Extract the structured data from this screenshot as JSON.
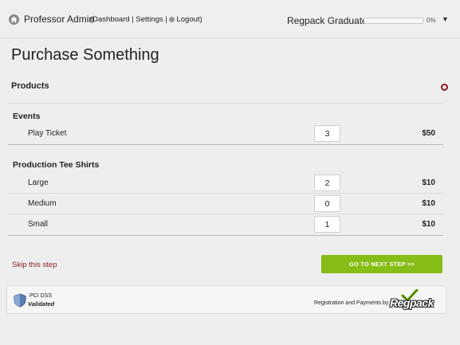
{
  "header": {
    "user_name": "Professor Admin",
    "paren_open": "(",
    "dashboard_link": "Dashboard",
    "sep1": " | ",
    "settings_link": "Settings",
    "sep2": " | ",
    "logout_link": "Logout",
    "paren_close": ")",
    "course_name": "Regpack Graduate",
    "progress_text": "0%",
    "progress_value": 0,
    "dropdown_caret": "▼"
  },
  "page": {
    "title": "Purchase Something"
  },
  "products": {
    "header": "Products",
    "sections": [
      {
        "title": "Events",
        "items": [
          {
            "label": "Play Ticket",
            "qty": "3",
            "price": "$50"
          }
        ]
      },
      {
        "title": "Production Tee Shirts",
        "items": [
          {
            "label": "Large",
            "qty": "2",
            "price": "$10"
          },
          {
            "label": "Medium",
            "qty": "0",
            "price": "$10"
          },
          {
            "label": "Small",
            "qty": "1",
            "price": "$10"
          }
        ]
      }
    ]
  },
  "actions": {
    "skip_label": "Skip this step",
    "next_label": "GO TO NEXT STEP >>"
  },
  "footer": {
    "pci_line1": "PCI DSS",
    "pci_line2": "Validated",
    "powered_by": "Registration and Payments by",
    "brand_name": "Regpack"
  },
  "colors": {
    "accent_green": "#86bd16",
    "link_red": "#8b1a1a"
  }
}
